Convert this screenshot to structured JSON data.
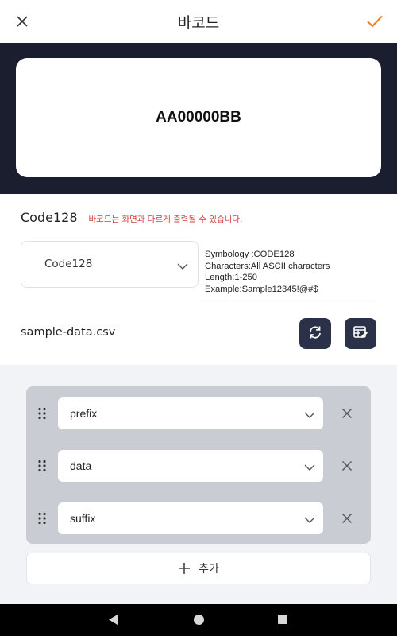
{
  "header": {
    "title": "바코드"
  },
  "preview": {
    "value": "AA00000BB"
  },
  "symbology": {
    "label": "Code128",
    "warning": "바코드는 화면과 다르게 출력될 수 있습니다.",
    "selected": "Code128",
    "info": [
      "Symbology :CODE128",
      "Characters:All ASCII characters",
      "Length:1-250",
      "Example:Sample12345!@#$"
    ]
  },
  "file": {
    "name": "sample-data.csv"
  },
  "fields": [
    {
      "value": "prefix"
    },
    {
      "value": "data"
    },
    {
      "value": "suffix"
    }
  ],
  "add_button": {
    "label": "추가"
  },
  "colors": {
    "accent": "#e8821e",
    "dark_band": "#1a1e2e",
    "icon_button": "#2a3148",
    "warning": "#d23c3c"
  }
}
